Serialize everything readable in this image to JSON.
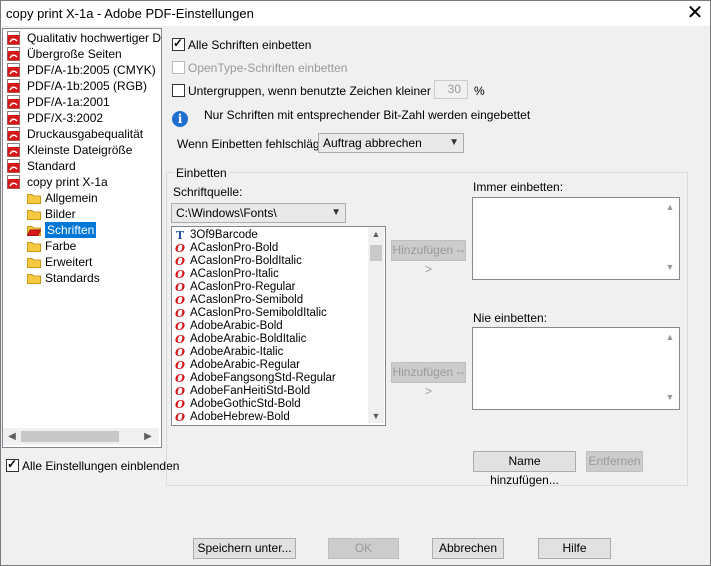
{
  "window": {
    "title": "copy print X-1a - Adobe PDF-Einstellungen",
    "close_glyph": "✕"
  },
  "tree": {
    "presets": [
      {
        "label": "Qualitativ hochwertiger Druck"
      },
      {
        "label": "Übergroße Seiten"
      },
      {
        "label": "PDF/A-1b:2005 (CMYK)"
      },
      {
        "label": "PDF/A-1b:2005 (RGB)"
      },
      {
        "label": "PDF/A-1a:2001"
      },
      {
        "label": "PDF/X-3:2002"
      },
      {
        "label": "Druckausgabequalität"
      },
      {
        "label": "Kleinste Dateigröße"
      },
      {
        "label": "Standard"
      },
      {
        "label": "copy print X-1a"
      }
    ],
    "sections": [
      {
        "label": "Allgemein"
      },
      {
        "label": "Bilder"
      },
      {
        "label": "Schriften",
        "selected": true
      },
      {
        "label": "Farbe"
      },
      {
        "label": "Erweitert"
      },
      {
        "label": "Standards"
      }
    ]
  },
  "show_all": {
    "label": "Alle Einstellungen einblenden",
    "checked": true
  },
  "options": {
    "embed_all": {
      "label": "Alle Schriften einbetten",
      "checked": true
    },
    "opentype": {
      "label": "OpenType-Schriften einbetten",
      "checked": false,
      "disabled": true
    },
    "subset": {
      "label": "Untergruppen, wenn benutzte Zeichen kleiner als:",
      "checked": false,
      "value": "30",
      "unit": "%"
    },
    "info_text": "Nur Schriften mit entsprechender Bit-Zahl werden eingebettet",
    "on_fail_label": "Wenn Einbetten fehlschlägt:",
    "on_fail_value": "Auftrag abbrechen"
  },
  "embed_group": {
    "title": "Einbetten",
    "source_label": "Schriftquelle:",
    "source_value": "C:\\Windows\\Fonts\\",
    "fonts": [
      {
        "name": "3Of9Barcode",
        "icon": "truetype-icon"
      },
      {
        "name": "ACaslonPro-Bold",
        "icon": "opentype-icon"
      },
      {
        "name": "ACaslonPro-BoldItalic",
        "icon": "opentype-icon"
      },
      {
        "name": "ACaslonPro-Italic",
        "icon": "opentype-icon"
      },
      {
        "name": "ACaslonPro-Regular",
        "icon": "opentype-icon"
      },
      {
        "name": "ACaslonPro-Semibold",
        "icon": "opentype-icon"
      },
      {
        "name": "ACaslonPro-SemiboldItalic",
        "icon": "opentype-icon"
      },
      {
        "name": "AdobeArabic-Bold",
        "icon": "opentype-icon"
      },
      {
        "name": "AdobeArabic-BoldItalic",
        "icon": "opentype-icon"
      },
      {
        "name": "AdobeArabic-Italic",
        "icon": "opentype-icon"
      },
      {
        "name": "AdobeArabic-Regular",
        "icon": "opentype-icon"
      },
      {
        "name": "AdobeFangsongStd-Regular",
        "icon": "opentype-icon"
      },
      {
        "name": "AdobeFanHeitiStd-Bold",
        "icon": "opentype-icon"
      },
      {
        "name": "AdobeGothicStd-Bold",
        "icon": "opentype-icon"
      },
      {
        "name": "AdobeHebrew-Bold",
        "icon": "opentype-icon"
      }
    ],
    "add_button_1": "Hinzufügen -->",
    "add_button_2": "Hinzufügen -->",
    "always_label": "Immer einbetten:",
    "never_label": "Nie einbetten:",
    "add_name_button": "Name hinzufügen...",
    "remove_button": "Entfernen"
  },
  "footer": {
    "save_as": "Speichern unter...",
    "ok": "OK",
    "cancel": "Abbrechen",
    "help": "Hilfe"
  },
  "colors": {
    "selection": "#0078d7",
    "pdf_icon": "#d81818",
    "info_icon": "#1e6fcf"
  }
}
